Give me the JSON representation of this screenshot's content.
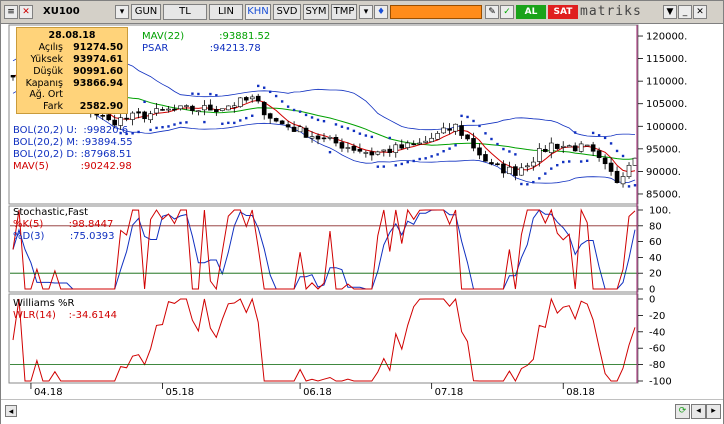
{
  "toolbar": {
    "symbol": "XU100",
    "periods": [
      {
        "label": "GUN",
        "active": false
      },
      {
        "label": "TL",
        "active": false
      },
      {
        "label": "LIN",
        "active": false
      },
      {
        "label": "KHN",
        "active": true
      },
      {
        "label": "SVD",
        "active": false
      },
      {
        "label": "SYM",
        "active": false
      },
      {
        "label": "TMP",
        "active": false
      }
    ],
    "al_label": "AL",
    "sat_label": "SAT",
    "brand": "matriks"
  },
  "info_box": {
    "date": "28.08.18",
    "rows": [
      {
        "key": "Açılış",
        "value": "91274.50"
      },
      {
        "key": "Yüksek",
        "value": "93974.61"
      },
      {
        "key": "Düşük",
        "value": "90991.60"
      },
      {
        "key": "Kapanış",
        "value": "93866.94"
      },
      {
        "key": "Ağ. Ort",
        "value": ""
      },
      {
        "key": "Fark",
        "value": "2582.90"
      }
    ]
  },
  "price_panel": {
    "legend_top": [
      {
        "name": "MAV(22)",
        "value": ":93881.52",
        "color": "#00a000"
      },
      {
        "name": "PSAR",
        "value": ":94213.78",
        "color": "#1030c0"
      }
    ],
    "legend_left": [
      {
        "name": "BOL(20,2) U:",
        "value": ":99820.6",
        "color": "#1030c0"
      },
      {
        "name": "BOL(20,2) M:",
        "value": ":93894.55",
        "color": "#1030c0"
      },
      {
        "name": "BOL(20,2) D:",
        "value": ":87968.51",
        "color": "#1030c0"
      },
      {
        "name": "MAV(5)",
        "value": ":90242.98",
        "color": "#d00000"
      }
    ],
    "axis_labels": [
      "120000.",
      "115000.",
      "110000.",
      "105000.",
      "100000.",
      "95000.",
      "90000.",
      "85000."
    ]
  },
  "stochastic_panel": {
    "title": "Stochastic,Fast",
    "k_label": "%K(5)",
    "k_value": ":98.8447",
    "d_label": "%D(3)",
    "d_value": ":75.0393",
    "axis_labels": [
      "100.",
      "80",
      "60",
      "40",
      "20",
      "0"
    ]
  },
  "williams_panel": {
    "title": "Williams %R",
    "label": "WLR(14)",
    "value": ":-34.6144",
    "axis_labels": [
      "0",
      "-20",
      "-40",
      "-60",
      "-80",
      "-100"
    ]
  },
  "x_axis": {
    "labels": [
      "04.18",
      "05.18",
      "06.18",
      "07.18",
      "08.18"
    ]
  },
  "colors": {
    "candle_up": "#ffffff",
    "candle_down": "#000000",
    "bollinger": "#1030c0",
    "mav22": "#00a000",
    "mav5": "#d00000",
    "psar": "#1030c0",
    "stoch_k": "#d00000",
    "stoch_d": "#1030c0",
    "williams": "#d00000",
    "guide_line": "#006000",
    "cursor_line": "#9b1b6b"
  },
  "chart_data": {
    "type": "line",
    "x": [
      "04.18",
      "05.18",
      "06.18",
      "07.18",
      "08.18"
    ],
    "series": [
      {
        "name": "MAV(22)",
        "values": [
          112000,
          104000,
          102000,
          94500,
          93881.52
        ]
      },
      {
        "name": "MAV(5)",
        "values": [
          110000,
          103000,
          101000,
          92000,
          90242.98
        ]
      },
      {
        "name": "PSAR",
        "values": [
          113000,
          100000,
          106000,
          93000,
          94213.78
        ]
      }
    ],
    "ylim": [
      83000,
      122000
    ],
    "grid": false
  }
}
